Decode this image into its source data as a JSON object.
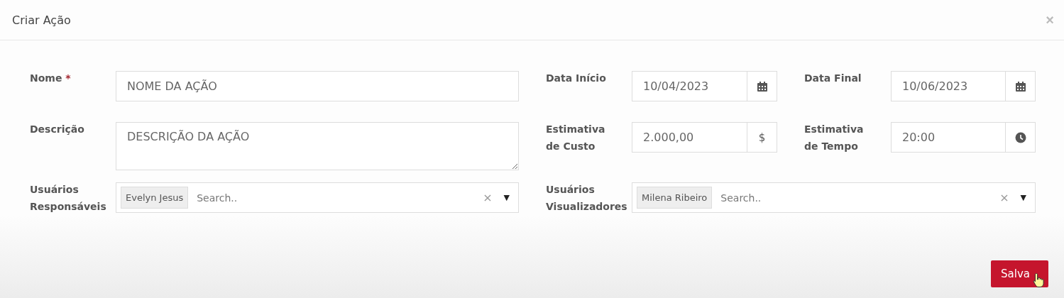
{
  "window": {
    "title": "Criar Ação",
    "close": "×"
  },
  "nome": {
    "label": "Nome",
    "required_mark": "*",
    "value": "NOME DA AÇÃO"
  },
  "data_inicio": {
    "label": "Data Início",
    "value": "10/04/2023",
    "kind": "date"
  },
  "data_final": {
    "label": "Data Final",
    "value": "10/06/2023",
    "kind": "date"
  },
  "descricao": {
    "label": "Descrição",
    "value": "DESCRIÇÃO DA AÇÃO"
  },
  "estimativa_custo": {
    "label": "Estimativa de Custo",
    "value": "2.000,00",
    "addon_text": "$"
  },
  "estimativa_tempo": {
    "label": "Estimativa de Tempo",
    "value": "20:00",
    "kind": "time"
  },
  "usuarios_responsaveis": {
    "label": "Usuários Responsáveis",
    "tags": [
      "Evelyn Jesus"
    ],
    "placeholder": "Search..",
    "clear": "×",
    "caret": "▼"
  },
  "usuarios_visualizadores": {
    "label": "Usuários Visualizadores",
    "tags": [
      "Milena Ribeiro"
    ],
    "placeholder": "Search..",
    "clear": "×",
    "caret": "▼"
  },
  "save_button": {
    "label": "Salva"
  }
}
